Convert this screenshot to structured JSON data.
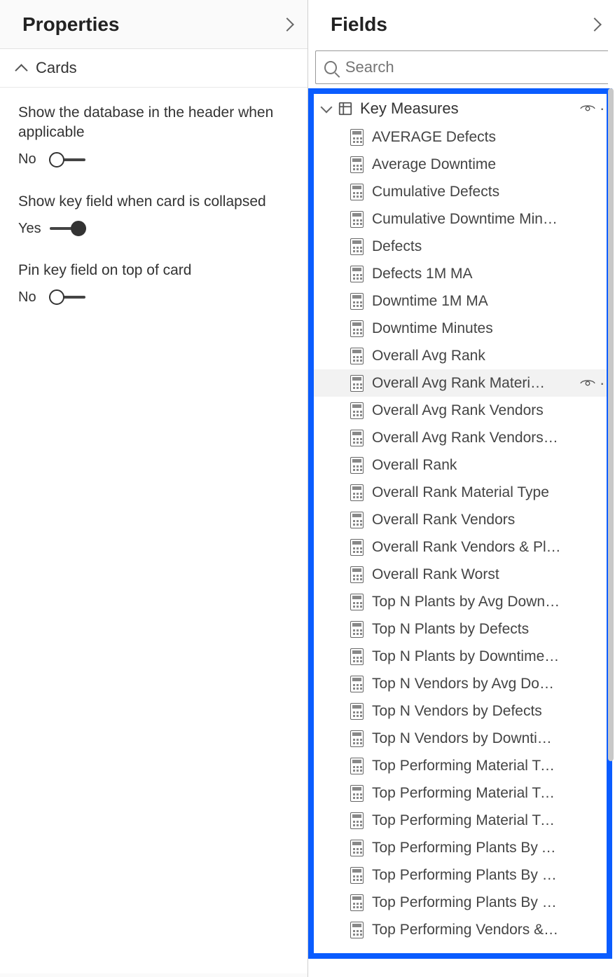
{
  "properties": {
    "title": "Properties",
    "section": "Cards",
    "items": [
      {
        "label": "Show the database in the header when applicable",
        "value": "No",
        "on": false
      },
      {
        "label": "Show key field when card is collapsed",
        "value": "Yes",
        "on": true
      },
      {
        "label": "Pin key field on top of card",
        "value": "No",
        "on": false
      }
    ]
  },
  "fields": {
    "title": "Fields",
    "searchPlaceholder": "Search",
    "table": "Key Measures",
    "hoveredIndex": 9,
    "items": [
      "AVERAGE Defects",
      "Average Downtime",
      "Cumulative Defects",
      "Cumulative Downtime Minutes",
      "Defects",
      "Defects 1M MA",
      "Downtime 1M MA",
      "Downtime Minutes",
      "Overall Avg Rank",
      "Overall Avg Rank Material Type",
      "Overall Avg Rank Vendors",
      "Overall Avg Rank Vendors Pla...",
      "Overall Rank",
      "Overall Rank Material Type",
      "Overall Rank Vendors",
      "Overall Rank Vendors & Plants",
      "Overall Rank Worst",
      "Top N Plants by Avg Downtim...",
      "Top N Plants by Defects",
      "Top N Plants by Downtime Mi...",
      "Top N Vendors by Avg Downt...",
      "Top N Vendors by Defects",
      "Top N Vendors by Downtime ...",
      "Top Performing Material Type...",
      "Top Performing Material Type...",
      "Top Performing Material Type...",
      "Top Performing Plants By Avg...",
      "Top Performing Plants By Def...",
      "Top Performing Plants By Do...",
      "Top Performing Vendors & Pl..."
    ]
  }
}
